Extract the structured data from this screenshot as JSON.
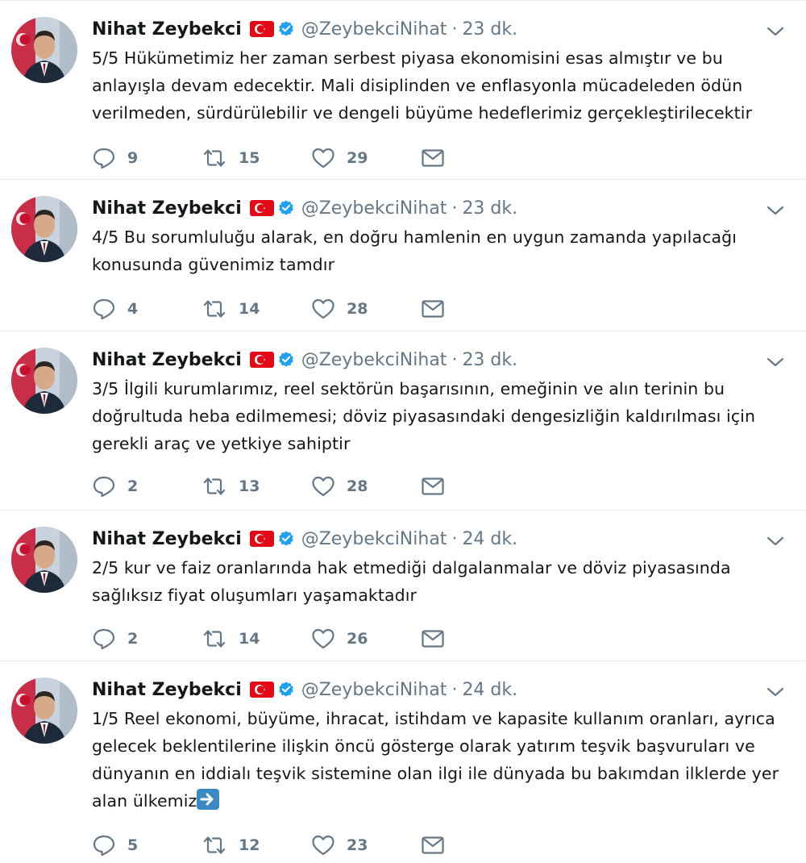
{
  "author": {
    "name": "Nihat Zeybekci",
    "handle": "@ZeybekciNihat",
    "flag_icon": "turkey-flag-icon",
    "verified_icon": "verified-badge-icon"
  },
  "colors": {
    "text": "#14171a",
    "secondary": "#657786",
    "verified": "#1da1f2",
    "flag_red": "#e30a17",
    "divider": "#e6ecf0"
  },
  "tweets": [
    {
      "time": "23 dk.",
      "text": "5/5 Hükümetimiz her zaman serbest piyasa ekonomisini esas almıştır ve bu\nanlayışla devam edecektir. Mali disiplinden ve enflasyonla mücadeleden ödün\nverilmeden, sürdürülebilir ve dengeli büyüme hedeflerimiz gerçekleştirilecektir",
      "replies": "9",
      "retweets": "15",
      "likes": "29"
    },
    {
      "time": "23 dk.",
      "text": "4/5 Bu sorumluluğu alarak, en doğru hamlenin en uygun zamanda yapılacağı\nkonusunda güvenimiz tamdır",
      "replies": "4",
      "retweets": "14",
      "likes": "28"
    },
    {
      "time": "23 dk.",
      "text": "3/5 İlgili kurumlarımız, reel sektörün başarısının, emeğinin ve alın terinin bu\ndoğrultuda heba edilmemesi; döviz piyasasındaki dengesizliğin kaldırılması için\ngerekli araç ve yetkiye sahiptir",
      "replies": "2",
      "retweets": "13",
      "likes": "28"
    },
    {
      "time": "24 dk.",
      "text": "2/5 kur ve faiz oranlarında hak etmediği dalgalanmalar ve döviz piyasasında\nsağlıksız fiyat oluşumları yaşamaktadır",
      "replies": "2",
      "retweets": "14",
      "likes": "26"
    },
    {
      "time": "24 dk.",
      "text": "1/5 Reel ekonomi, büyüme, ihracat, istihdam ve kapasite kullanım oranları, ayrıca\ngelecek beklentilerine ilişkin öncü gösterge olarak yatırım teşvik başvuruları ve\ndünyanın en iddialı teşvik sistemine olan ilgi ile dünyada bu bakımdan ilklerde yer\nalan ülkemiz",
      "emoji": "right-arrow-emoji-icon",
      "replies": "5",
      "retweets": "12",
      "likes": "23"
    }
  ]
}
